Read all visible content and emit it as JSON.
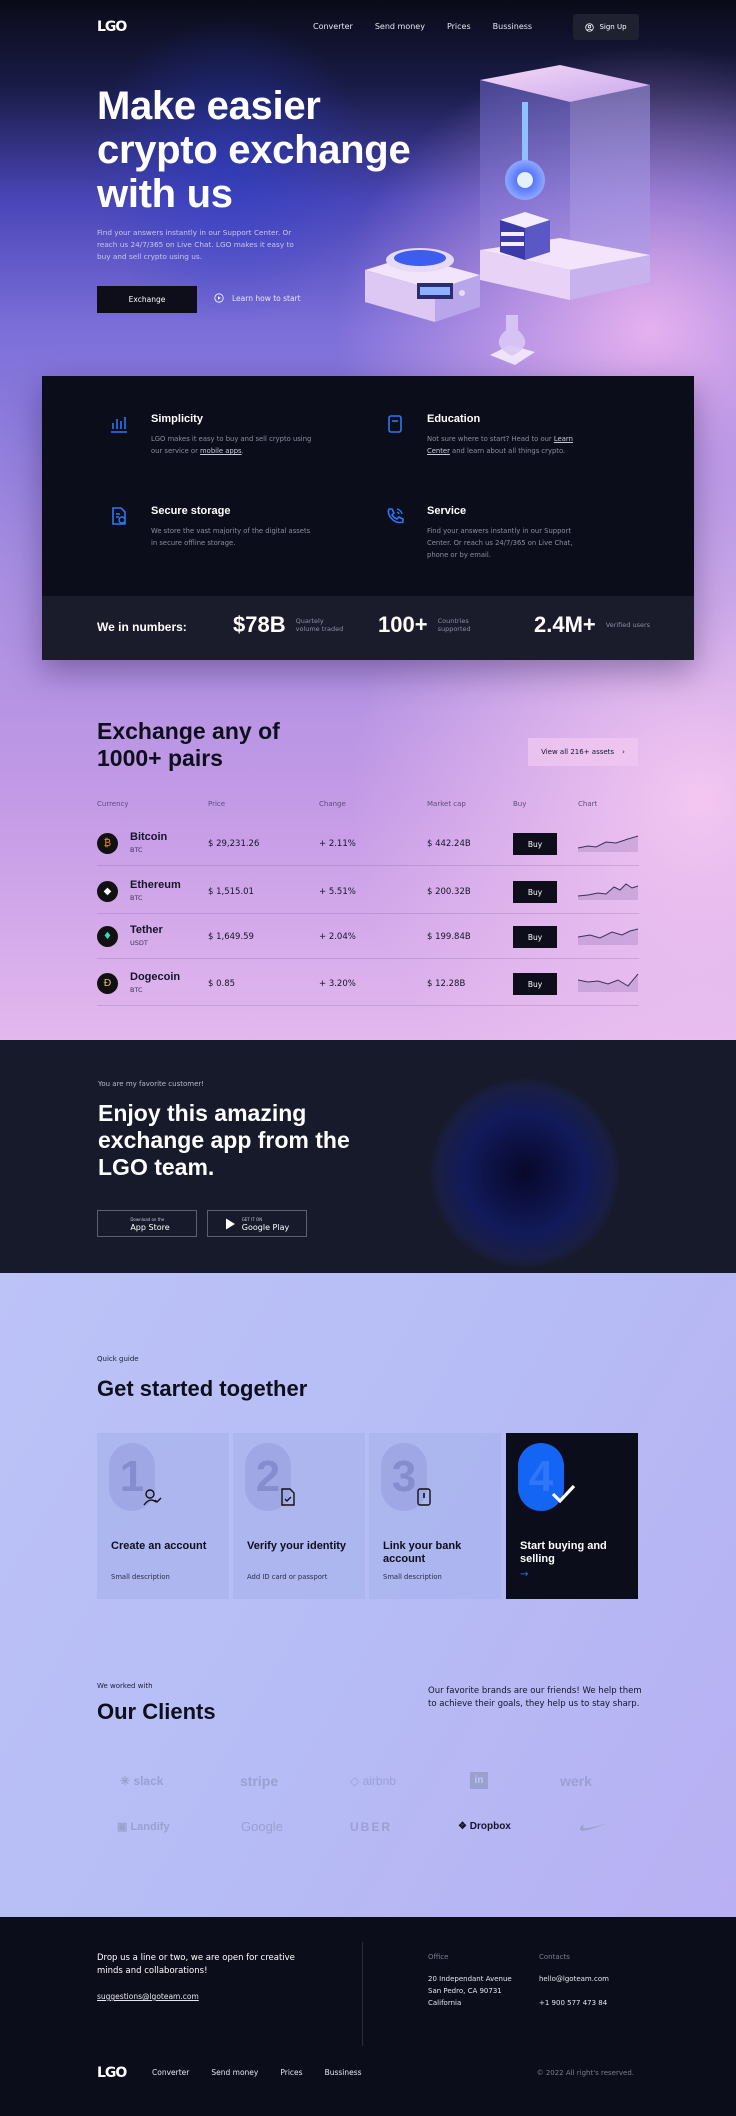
{
  "nav": {
    "logo": "LGO",
    "links": [
      "Converter",
      "Send money",
      "Prices",
      "Bussiness"
    ],
    "signup": "Sign Up"
  },
  "hero": {
    "title": "Make easier crypto exchange with us",
    "subtitle": "Find your answers instantly in our Support Center. Or reach us 24/7/365 on Live Chat. LGO makes it easy to buy and sell crypto using us.",
    "exchange_button": "Exchange",
    "learn_link": "Learn how to start"
  },
  "features": [
    {
      "title": "Simplicity",
      "icon": "chart-icon",
      "text": "LGO makes it easy to buy and sell crypto using our service or ",
      "link": "mobile apps",
      "after": "."
    },
    {
      "title": "Education",
      "icon": "book-icon",
      "text": "Not sure where to start? Head to our ",
      "link": "Learn Center",
      "after": " and learn about all things crypto."
    },
    {
      "title": "Secure storage",
      "icon": "secure-doc-icon",
      "text": "We store the vast majority of the digital assets in secure offline storage.",
      "link": "",
      "after": ""
    },
    {
      "title": "Service",
      "icon": "phone-icon",
      "text": "Find your answers instantly in our Support Center. Or reach us 24/7/365 on Live Chat, phone or by email.",
      "link": "",
      "after": ""
    }
  ],
  "numbers": {
    "label": "We in numbers:",
    "items": [
      {
        "value": "$78B",
        "caption": "Quartely volume traded"
      },
      {
        "value": "100+",
        "caption": "Countries supported"
      },
      {
        "value": "2.4M+",
        "caption": "Verified users"
      }
    ]
  },
  "exchange": {
    "title": "Exchange any of 1000+ pairs",
    "view_all": "View all 216+ assets",
    "columns": [
      "Currency",
      "Price",
      "Change",
      "Market cap",
      "Buy",
      "Chart"
    ],
    "rows": [
      {
        "name": "Bitcoin",
        "ticker": "BTC",
        "price": "$ 29,231.26",
        "change": "+ 2.11%",
        "cap": "$ 442.24B",
        "buy": "Buy",
        "symbol": "₿",
        "color": "#f7931a"
      },
      {
        "name": "Ethereum",
        "ticker": "BTC",
        "price": "$ 1,515.01",
        "change": "+ 5.51%",
        "cap": "$ 200.32B",
        "buy": "Buy",
        "symbol": "◆",
        "color": "#ffffff"
      },
      {
        "name": "Tether",
        "ticker": "USDT",
        "price": "$ 1,649.59",
        "change": "+ 2.04%",
        "cap": "$ 199.84B",
        "buy": "Buy",
        "symbol": "♦",
        "color": "#26e0c8"
      },
      {
        "name": "Dogecoin",
        "ticker": "BTC",
        "price": "$ 0.85",
        "change": "+ 3.20%",
        "cap": "$ 12.28B",
        "buy": "Buy",
        "symbol": "Ð",
        "color": "#e0c060"
      }
    ]
  },
  "app": {
    "kicker": "You are my favorite customer!",
    "title": "Enjoy this amazing exchange app from the LGO team.",
    "appstore_small": "Download on the",
    "appstore": "App Store",
    "gplay_small": "GET IT ON",
    "gplay": "Google Play"
  },
  "guide": {
    "kicker": "Quick guide",
    "title": "Get started together",
    "steps": [
      {
        "num": "1",
        "title": "Create an account",
        "desc": "Small description",
        "icon": "user-check-icon"
      },
      {
        "num": "2",
        "title": "Verify your identity",
        "desc": "Add ID card or passport",
        "icon": "doc-check-icon"
      },
      {
        "num": "3",
        "title": "Link your bank account",
        "desc": "Small description",
        "icon": "card-icon"
      },
      {
        "num": "4",
        "title": "Start buying and selling",
        "desc": "→",
        "icon": "check-icon"
      }
    ]
  },
  "clients": {
    "kicker": "We worked with",
    "title": "Our Clients",
    "note": "Our favorite brands are our friends! We help them to achieve their goals, they help us to stay sharp.",
    "logos": [
      "slack",
      "stripe",
      "airbnb",
      "in",
      "werk",
      "Landify",
      "Google",
      "UBER",
      "Dropbox",
      "nike"
    ]
  },
  "footer": {
    "message": "Drop us a line or two, we are open for creative minds and collaborations!",
    "email": "suggestions@lgoteam.com",
    "office_label": "Office",
    "office": [
      "20 Independant Avenue",
      "San Pedro, CA 90731",
      "California"
    ],
    "contacts_label": "Contacts",
    "contact_email": "hello@lgoteam.com",
    "phone": "+1 900 577 473 84",
    "links": [
      "Converter",
      "Send money",
      "Prices",
      "Bussiness"
    ],
    "copyright": "© 2022 All right's reserved."
  },
  "colors": {
    "accent": "#1565f5",
    "dark": "#0c0d1a",
    "feature_icon": "#2a78f5"
  }
}
